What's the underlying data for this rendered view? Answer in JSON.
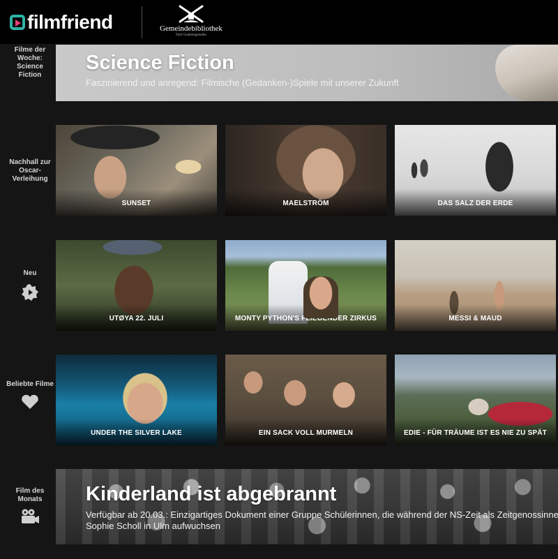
{
  "header": {
    "logo_text": "filmfriend",
    "library_name": "Gemeindebibliothek",
    "library_sub": "Dorf Gaukönigshofen"
  },
  "sidebar": {
    "filme_der_woche": "Filme der Woche: Science Fiction",
    "nachhall": "Nachhall zur Oscar-Verleihung",
    "neu": "Neu",
    "beliebte_filme": "Beliebte Filme",
    "film_des_monats": "Film des Monats"
  },
  "featured": {
    "title": "Science Fiction",
    "subtitle": "Faszinierend und anregend: Filmische (Gedanken-)Spiele mit unserer Zukunft"
  },
  "rows": [
    {
      "tiles": [
        {
          "title": "SUNSET"
        },
        {
          "title": "MAELSTRÖM"
        },
        {
          "title": "DAS SALZ DER ERDE"
        }
      ]
    },
    {
      "tiles": [
        {
          "title": "UTØYA 22. JULI"
        },
        {
          "title": "MONTY PYTHON'S FLIEGENDER ZIRKUS"
        },
        {
          "title": "MESSI & MAUD"
        }
      ]
    },
    {
      "tiles": [
        {
          "title": "UNDER THE SILVER LAKE"
        },
        {
          "title": "EIN SACK VOLL MURMELN"
        },
        {
          "title": "EDIE - FÜR TRÄUME IST ES NIE ZU SPÄT"
        }
      ]
    }
  ],
  "film_des_monats": {
    "title": "Kinderland ist abgebrannt",
    "description": "Verfügbar ab 20.03.: Einzigartiges Dokument einer Gruppe Schülerinnen, die während der NS-Zeit als Zeitgenossinnen von Sophie Scholl in Ulm aufwuchsen"
  },
  "icons": {
    "neu": "gear-badge-icon",
    "beliebte_filme": "heart-icon",
    "film_des_monats": "film-camera-icon"
  },
  "colors": {
    "brand_teal": "#2fb3a6",
    "brand_pink": "#e8417a",
    "background": "#151515",
    "header": "#000000"
  }
}
